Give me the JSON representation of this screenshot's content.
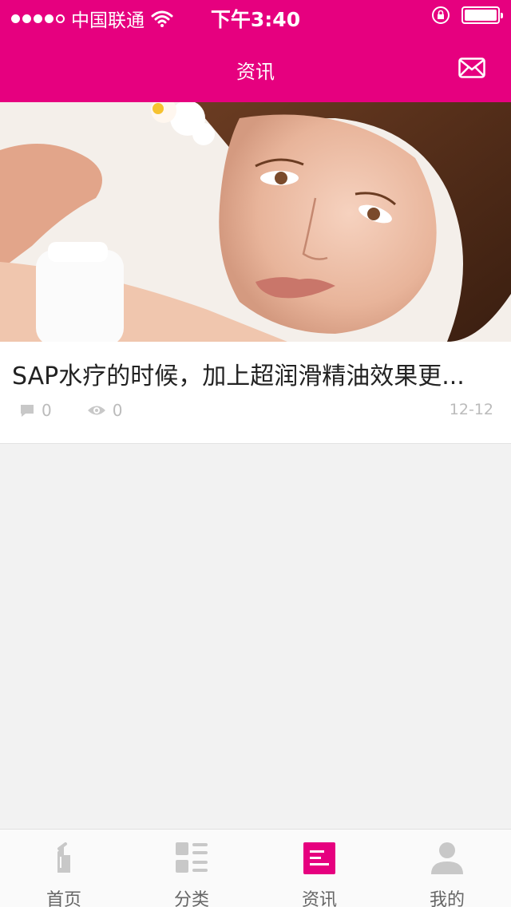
{
  "status_bar": {
    "carrier": "中国联通",
    "time": "下午3:40"
  },
  "nav": {
    "title": "资讯",
    "right_icon": "mail-icon"
  },
  "article": {
    "title": "SAP水疗的时候，加上超润滑精油效果更...",
    "comments": "0",
    "views": "0",
    "date": "12-12"
  },
  "tabs": [
    {
      "label": "首页",
      "icon": "home-icon"
    },
    {
      "label": "分类",
      "icon": "category-icon"
    },
    {
      "label": "资讯",
      "icon": "news-icon",
      "active": true
    },
    {
      "label": "我的",
      "icon": "profile-icon"
    }
  ],
  "colors": {
    "brand": "#e6007f",
    "muted": "#bbbbbb",
    "background": "#f2f2f2"
  }
}
